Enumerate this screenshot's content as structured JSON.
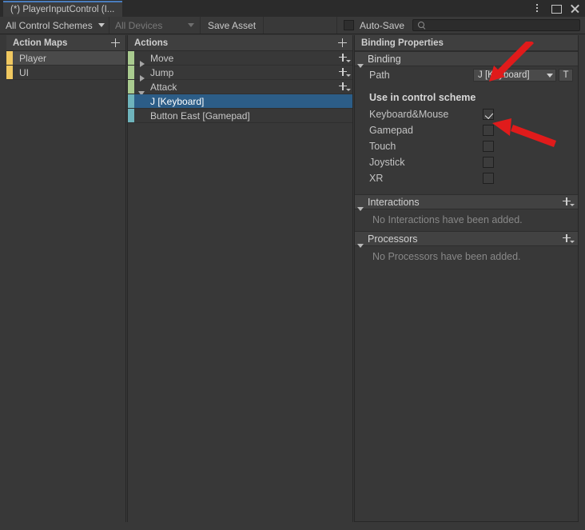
{
  "window": {
    "tab_title": "(*) PlayerInputControl (I...",
    "controls": [
      {
        "name": "more-options",
        "icon": "vertical-dots-icon"
      },
      {
        "name": "maximize",
        "icon": "maximize-icon"
      },
      {
        "name": "close",
        "icon": "close-icon"
      }
    ]
  },
  "toolbar": {
    "control_schemes": "All Control Schemes",
    "devices": "All Devices",
    "save_asset": "Save Asset",
    "auto_save": "Auto-Save",
    "auto_save_checked": false,
    "search_placeholder": "",
    "search_value": ""
  },
  "action_maps": {
    "title": "Action Maps",
    "add_label": "+",
    "accent_color": "#f0c860",
    "items": [
      {
        "label": "Player",
        "selected": true
      },
      {
        "label": "UI",
        "selected": false
      }
    ]
  },
  "actions": {
    "title": "Actions",
    "add_label": "+",
    "action_accent_color": "#a9cb8f",
    "binding_accent_color": "#6fb4bc",
    "items": [
      {
        "label": "Move",
        "type": "action",
        "expanded": false,
        "selected": false
      },
      {
        "label": "Jump",
        "type": "action",
        "expanded": false,
        "selected": false
      },
      {
        "label": "Attack",
        "type": "action",
        "expanded": true,
        "selected": false
      },
      {
        "label": "J [Keyboard]",
        "type": "binding",
        "selected": true
      },
      {
        "label": "Button East [Gamepad]",
        "type": "binding",
        "selected": false
      }
    ]
  },
  "properties": {
    "title": "Binding Properties",
    "binding_section": {
      "title": "Binding",
      "path_label": "Path",
      "path_value": "J [Keyboard]",
      "path_button_label": "T"
    },
    "control_scheme": {
      "title": "Use in control scheme",
      "schemes": [
        {
          "label": "Keyboard&Mouse",
          "checked": true
        },
        {
          "label": "Gamepad",
          "checked": false
        },
        {
          "label": "Touch",
          "checked": false
        },
        {
          "label": "Joystick",
          "checked": false
        },
        {
          "label": "XR",
          "checked": false
        }
      ]
    },
    "interactions": {
      "title": "Interactions",
      "empty_text": "No Interactions have been added."
    },
    "processors": {
      "title": "Processors",
      "empty_text": "No Processors have been added."
    }
  },
  "annotations": {
    "arrow_color": "#e01b1b",
    "arrows": [
      {
        "name": "arrow-to-path-field",
        "target": "path-dropdown"
      },
      {
        "name": "arrow-to-keyboard-check",
        "target": "keyboard-mouse-checkbox"
      }
    ]
  }
}
